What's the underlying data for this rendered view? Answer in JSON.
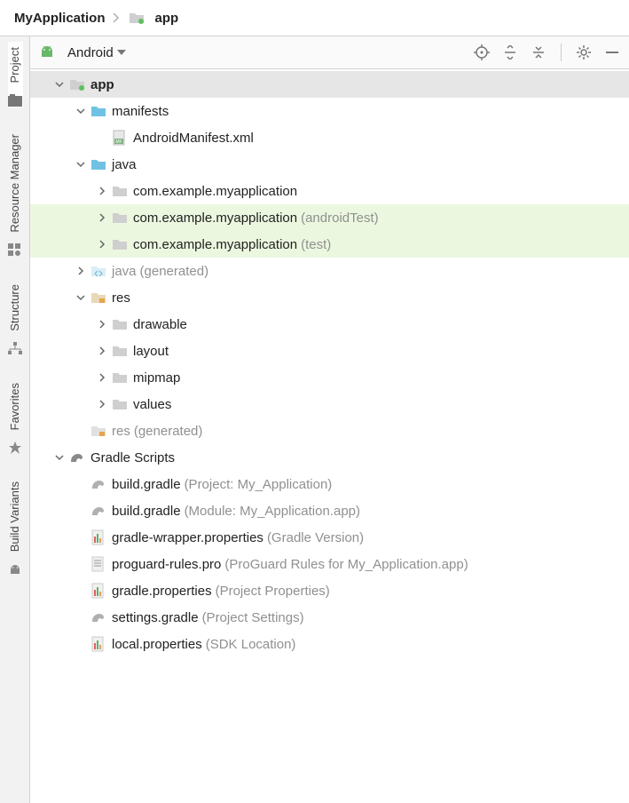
{
  "breadcrumb": {
    "root": "MyApplication",
    "child": "app"
  },
  "panel": {
    "view": "Android"
  },
  "rail": {
    "project": "Project",
    "resource_manager": "Resource Manager",
    "structure": "Structure",
    "favorites": "Favorites",
    "build_variants": "Build Variants"
  },
  "tree": {
    "app": {
      "label": "app"
    },
    "manifests": {
      "label": "manifests"
    },
    "android_manifest": {
      "label": "AndroidManifest.xml"
    },
    "java": {
      "label": "java"
    },
    "pkg_main": {
      "label": "com.example.myapplication"
    },
    "pkg_androidtest": {
      "label": "com.example.myapplication",
      "suffix": "(androidTest)"
    },
    "pkg_test": {
      "label": "com.example.myapplication",
      "suffix": "(test)"
    },
    "java_gen": {
      "label": "java",
      "suffix": "(generated)"
    },
    "res": {
      "label": "res"
    },
    "drawable": {
      "label": "drawable"
    },
    "layout": {
      "label": "layout"
    },
    "mipmap": {
      "label": "mipmap"
    },
    "values": {
      "label": "values"
    },
    "res_gen": {
      "label": "res",
      "suffix": "(generated)"
    },
    "gradle_scripts": {
      "label": "Gradle Scripts"
    },
    "build_gradle_project": {
      "label": "build.gradle",
      "suffix": "(Project: My_Application)"
    },
    "build_gradle_module": {
      "label": "build.gradle",
      "suffix": "(Module: My_Application.app)"
    },
    "gradle_wrapper": {
      "label": "gradle-wrapper.properties",
      "suffix": "(Gradle Version)"
    },
    "proguard": {
      "label": "proguard-rules.pro",
      "suffix": "(ProGuard Rules for My_Application.app)"
    },
    "gradle_properties": {
      "label": "gradle.properties",
      "suffix": "(Project Properties)"
    },
    "settings_gradle": {
      "label": "settings.gradle",
      "suffix": "(Project Settings)"
    },
    "local_properties": {
      "label": "local.properties",
      "suffix": "(SDK Location)"
    }
  }
}
